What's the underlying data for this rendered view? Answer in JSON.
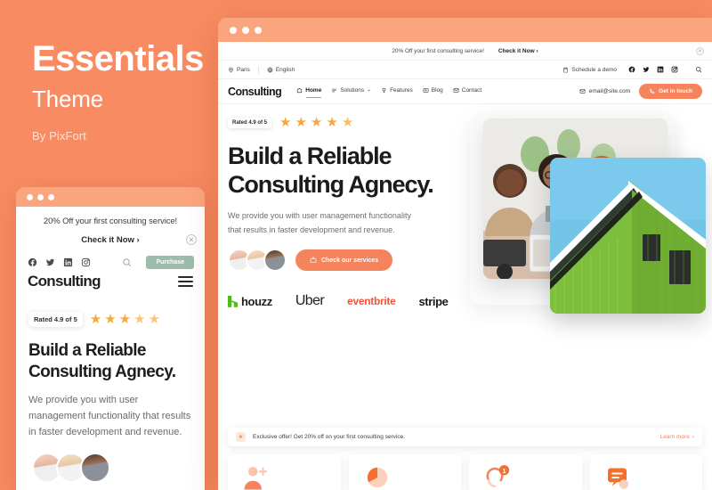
{
  "promo": {
    "title": "Essentials",
    "subtitle": "Theme",
    "byline": "By PixFort"
  },
  "colors": {
    "background": "#F98B62",
    "window_bar": "#FBA57F",
    "accent": "#F5835C",
    "star": "#F6A93B",
    "houzz_green": "#4DBC15",
    "eventbrite_red": "#F0563A",
    "purchase_green": "#9DBCAE"
  },
  "mobile": {
    "promo_text": "20% Off your first consulting service!",
    "check_it_now": "Check it Now ›",
    "close_icon": "close-icon",
    "socials": [
      "facebook-icon",
      "twitter-icon",
      "linkedin-icon",
      "instagram-icon"
    ],
    "search_icon": "search-icon",
    "purchase_label": "Purchase",
    "logo": "Consulting",
    "menu_icon": "hamburger-menu-icon",
    "rating_label": "Rated 4.9 of 5",
    "stars": 5,
    "heading_line1": "Build a Reliable",
    "heading_line2": "Consulting Agnecy.",
    "paragraph": "We provide you with user management functionality that results in faster development and revenue."
  },
  "browser": {
    "window_dots": 3,
    "promo_bar": {
      "text": "20% Off your first consulting service!",
      "link": "Check it Now ›",
      "close_icon": "close-icon"
    },
    "top_bar": {
      "location": "Paris",
      "location_icon": "map-pin-icon",
      "language": "English",
      "language_icon": "globe-icon",
      "schedule": "Schedule a demo",
      "schedule_icon": "calendar-icon",
      "socials": [
        "facebook-icon",
        "twitter-icon",
        "linkedin-icon",
        "instagram-icon"
      ],
      "search_icon": "search-icon"
    },
    "nav": {
      "logo": "Consulting",
      "items": [
        {
          "label": "Home",
          "icon": "home-icon",
          "active": true
        },
        {
          "label": "Solutions",
          "icon": "list-icon",
          "caret": "chevron-down-icon",
          "active": false
        },
        {
          "label": "Features",
          "icon": "trophy-icon",
          "active": false
        },
        {
          "label": "Blog",
          "icon": "news-icon",
          "active": false
        },
        {
          "label": "Contact",
          "icon": "envelope-icon",
          "active": false
        }
      ],
      "email": "email@site.com",
      "email_icon": "envelope-icon",
      "cta_label": "Get in touch",
      "cta_icon": "phone-icon"
    },
    "hero": {
      "rating_label": "Rated 4.9 of 5",
      "stars": 5,
      "heading_line1": "Build a Reliable",
      "heading_line2": "Consulting Agnecy.",
      "paragraph_line1": "We provide you with user management functionality",
      "paragraph_line2": "that results in faster development and revenue.",
      "cta_label": "Check our services",
      "cta_icon": "briefcase-icon",
      "avatars": 3
    },
    "brands": [
      {
        "name": "houzz",
        "icon": "houzz-logo"
      },
      {
        "name": "Uber",
        "icon": "uber-logo"
      },
      {
        "name": "eventbrite",
        "icon": "eventbrite-logo"
      },
      {
        "name": "stripe",
        "icon": "stripe-logo"
      }
    ],
    "offer": {
      "icon": "gift-icon",
      "text": "Exclusive offer! Get 20% off on your first consulting service.",
      "link": "Learn more",
      "link_arrow": "›"
    },
    "cards": [
      {
        "icon": "add-user-icon"
      },
      {
        "icon": "pie-chart-icon"
      },
      {
        "icon": "notification-bell-icon",
        "badge": "1"
      },
      {
        "icon": "chat-message-icon"
      }
    ]
  }
}
